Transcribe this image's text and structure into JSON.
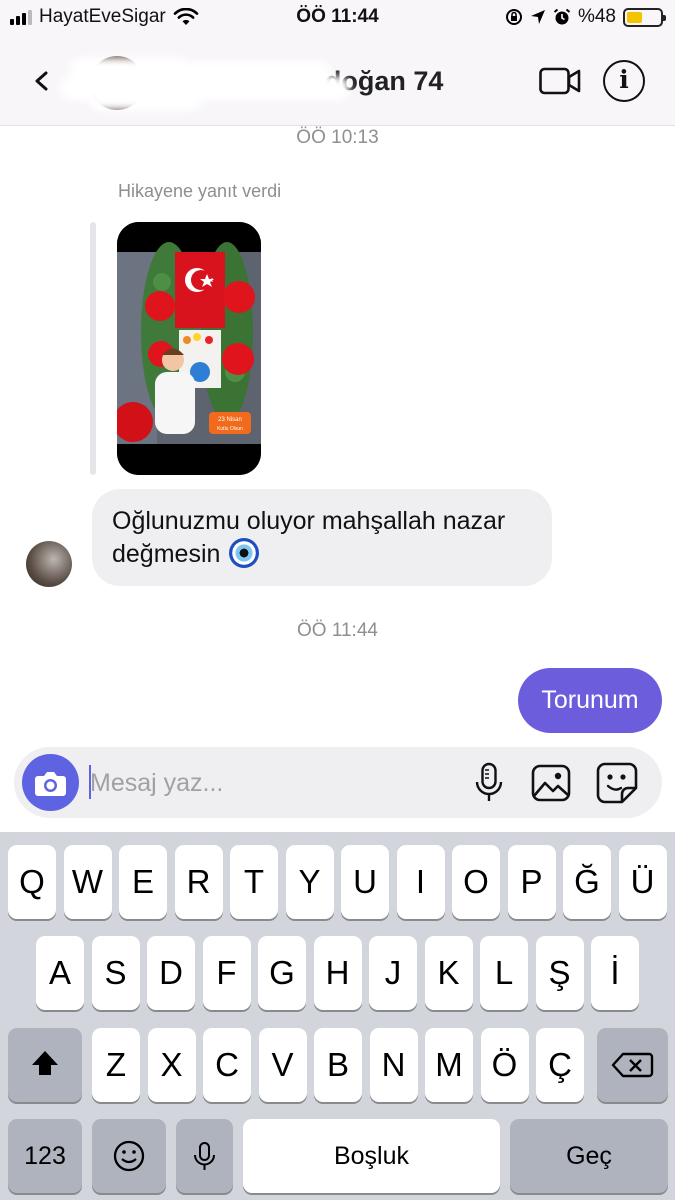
{
  "status_bar": {
    "carrier": "HayatEveSigar",
    "time": "ÖÖ 11:44",
    "battery": "%48",
    "battery_level_percent": 48
  },
  "header": {
    "contact_name": "· · · · · · · · · · doğan 74",
    "icons": [
      "chevron-left-icon",
      "video-camera-icon",
      "info-icon"
    ]
  },
  "chat": {
    "timestamp_1": "ÖÖ 10:13",
    "story_reply_note": "Hikayene yanıt verdi",
    "story_badge_line1": "23 Nisan",
    "story_badge_line2": "Kutlu Olsun",
    "incoming_message": "Oğlunuzmu oluyor mahşallah nazar değmesin",
    "timestamp_2": "ÖÖ 11:44",
    "outgoing_message": "Torunum"
  },
  "composer": {
    "placeholder": "Mesaj yaz...",
    "value": ""
  },
  "keyboard": {
    "row1": [
      "Q",
      "W",
      "E",
      "R",
      "T",
      "Y",
      "U",
      "I",
      "O",
      "P",
      "Ğ",
      "Ü"
    ],
    "row2": [
      "A",
      "S",
      "D",
      "F",
      "G",
      "H",
      "J",
      "K",
      "L",
      "Ş",
      "İ"
    ],
    "row3": [
      "Z",
      "X",
      "C",
      "V",
      "B",
      "N",
      "M",
      "Ö",
      "Ç"
    ],
    "numbers_label": "123",
    "space_label": "Boşluk",
    "return_label": "Geç"
  },
  "colors": {
    "accent": "#6c5ddd",
    "camera_button": "#5e63e1",
    "incoming_bubble": "#efeef1",
    "keyboard_bg": "#d2d5db"
  }
}
